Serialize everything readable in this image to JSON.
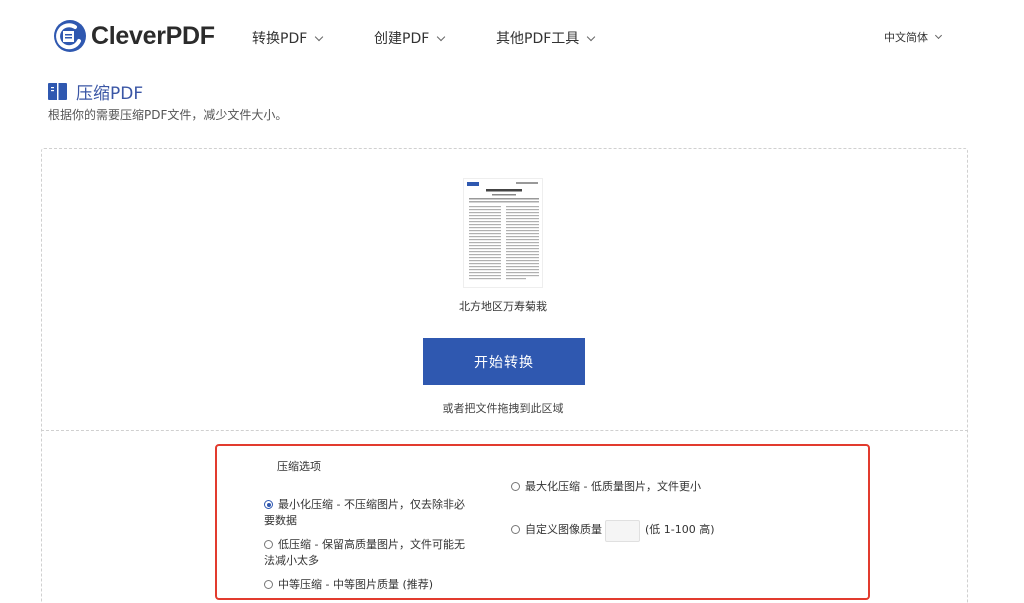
{
  "brand": {
    "name": "CleverPDF",
    "accent": "#2f58b0",
    "highlight_border": "#e23b2e"
  },
  "nav": {
    "items": [
      {
        "label": "转换PDF"
      },
      {
        "label": "创建PDF"
      },
      {
        "label": "其他PDF工具"
      }
    ],
    "language": "中文简体"
  },
  "page": {
    "title": "压缩PDF",
    "subtitle": "根据你的需要压缩PDF文件，减少文件大小。"
  },
  "upload": {
    "file_name": "北方地区万寿菊栽",
    "start_button": "开始转换",
    "drop_hint": "或者把文件拖拽到此区域"
  },
  "options": {
    "title": "压缩选项",
    "left": [
      {
        "label_line1": "最小化压缩 - 不压缩图片，仅去除非必",
        "label_line2": "要数据",
        "checked": true
      },
      {
        "label_line1": "低压缩 - 保留高质量图片，文件可能无",
        "label_line2": "法减小太多",
        "checked": false
      },
      {
        "label_line1": "中等压缩 - 中等图片质量 (推荐)",
        "label_line2": "",
        "checked": false
      }
    ],
    "right": [
      {
        "label": "最大化压缩 - 低质量图片，文件更小",
        "checked": false
      },
      {
        "label": "自定义图像质量",
        "checked": false
      }
    ],
    "quality_hint": "(低 1-100 高)",
    "quality_value": ""
  },
  "icons": {
    "logo": "cleverpdf-logo-icon",
    "title": "book-icon",
    "nav_caret": "chevron-down-icon"
  }
}
